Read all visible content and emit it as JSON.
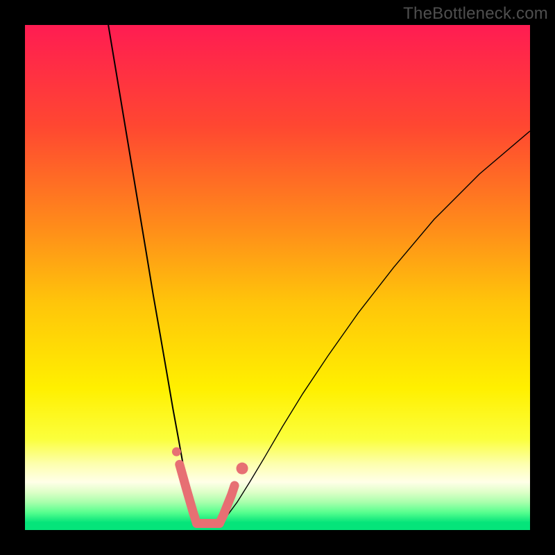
{
  "watermark": "TheBottleneck.com",
  "chart_data": {
    "type": "line",
    "title": "",
    "xlabel": "",
    "ylabel": "",
    "xlim": [
      0,
      100
    ],
    "ylim": [
      0,
      100
    ],
    "background_gradient": {
      "type": "vertical",
      "stops": [
        {
          "pos": 0.0,
          "color": "#ff1c52"
        },
        {
          "pos": 0.2,
          "color": "#ff4731"
        },
        {
          "pos": 0.4,
          "color": "#ff8c1a"
        },
        {
          "pos": 0.55,
          "color": "#ffc50a"
        },
        {
          "pos": 0.72,
          "color": "#fff000"
        },
        {
          "pos": 0.82,
          "color": "#fbff3c"
        },
        {
          "pos": 0.87,
          "color": "#fdffb0"
        },
        {
          "pos": 0.905,
          "color": "#ffffe8"
        },
        {
          "pos": 0.925,
          "color": "#deffc8"
        },
        {
          "pos": 0.945,
          "color": "#a8ffac"
        },
        {
          "pos": 0.965,
          "color": "#58ff8f"
        },
        {
          "pos": 0.985,
          "color": "#05e47a"
        },
        {
          "pos": 1.0,
          "color": "#05e47a"
        }
      ]
    },
    "series": [
      {
        "name": "left-branch",
        "stroke": "#000000",
        "width": 2,
        "x": [
          16.5,
          18.0,
          19.5,
          21.0,
          22.5,
          24.0,
          25.4,
          26.8,
          28.1,
          29.3,
          30.4,
          31.3,
          32.0,
          32.7,
          33.3,
          34.2,
          35.5
        ],
        "y": [
          100.0,
          91.0,
          82.0,
          73.0,
          64.0,
          55.0,
          46.5,
          38.5,
          31.0,
          24.0,
          18.0,
          13.0,
          9.0,
          6.0,
          4.0,
          2.3,
          1.5
        ]
      },
      {
        "name": "right-branch",
        "stroke": "#000000",
        "width": 1.4,
        "x": [
          38.5,
          40.0,
          42.0,
          44.5,
          47.5,
          51.0,
          55.0,
          60.0,
          66.0,
          73.0,
          81.0,
          90.0,
          100.0
        ],
        "y": [
          1.5,
          2.8,
          5.5,
          9.5,
          14.5,
          20.5,
          27.0,
          34.5,
          43.0,
          52.0,
          61.5,
          70.5,
          79.0
        ]
      },
      {
        "name": "valley-floor",
        "stroke": "#e76f73",
        "width": 13,
        "linecap": "round",
        "x": [
          34.0,
          38.5
        ],
        "y": [
          1.3,
          1.3
        ]
      },
      {
        "name": "valley-left-stub",
        "stroke": "#e76f73",
        "width": 13,
        "linecap": "round",
        "x": [
          30.6,
          32.0,
          33.3,
          34.0
        ],
        "y": [
          13.0,
          8.0,
          3.5,
          1.3
        ]
      },
      {
        "name": "valley-right-stub",
        "stroke": "#e76f73",
        "width": 13,
        "linecap": "round",
        "x": [
          38.5,
          39.3,
          40.1,
          40.9,
          41.5
        ],
        "y": [
          1.3,
          3.0,
          5.0,
          7.0,
          8.8
        ]
      }
    ],
    "points": [
      {
        "name": "upper-right-dot",
        "x": 43.0,
        "y": 12.2,
        "r": 8.5,
        "fill": "#e76f73"
      },
      {
        "name": "upper-left-dot",
        "x": 30.0,
        "y": 15.5,
        "r": 6.5,
        "fill": "#e76f73"
      }
    ]
  }
}
